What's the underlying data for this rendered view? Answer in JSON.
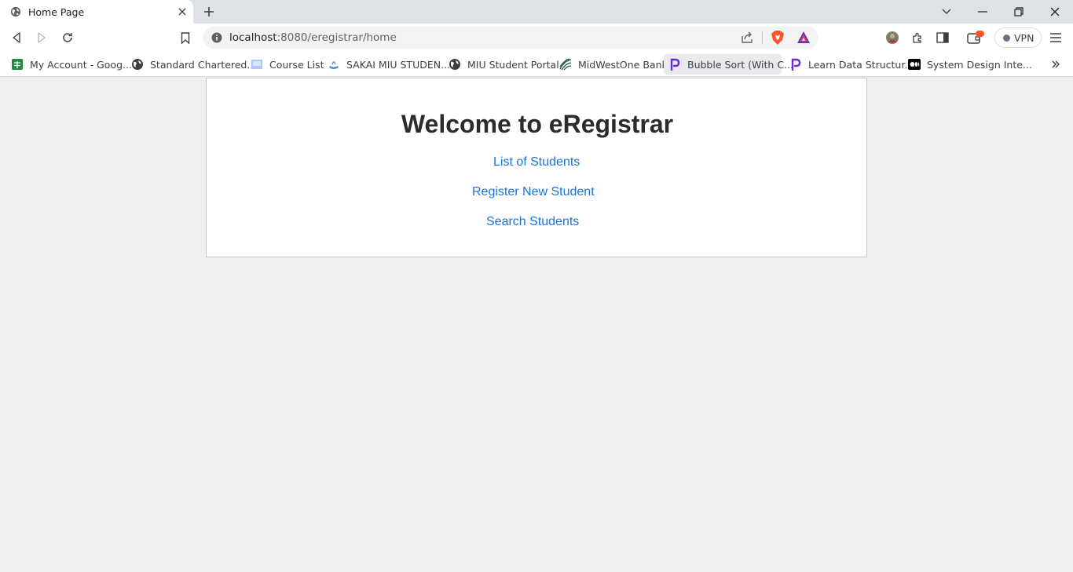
{
  "browser": {
    "tab": {
      "title": "Home Page"
    },
    "address_bar": {
      "host": "localhost",
      "path": ":8080/eregistrar/home"
    },
    "vpn_label": "VPN",
    "bookmarks": [
      {
        "label": "My Account - Goog...",
        "icon": "google-sheets-icon"
      },
      {
        "label": "Standard Chartered...",
        "icon": "globe-icon"
      },
      {
        "label": "Course List",
        "icon": "page-icon"
      },
      {
        "label": "SAKAI MIU STUDEN...",
        "icon": "sakai-icon"
      },
      {
        "label": "MIU Student Portal",
        "icon": "globe-icon"
      },
      {
        "label": "MidWestOne Bank",
        "icon": "bank-icon"
      },
      {
        "label": "Bubble Sort (With C...",
        "icon": "p-logo-icon"
      },
      {
        "label": "Learn Data Structur...",
        "icon": "p-logo-icon"
      },
      {
        "label": "System Design Inte...",
        "icon": "medium-icon"
      }
    ]
  },
  "page": {
    "heading": "Welcome to eRegistrar",
    "links": {
      "list_students": "List of Students",
      "register_student": "Register New Student",
      "search_students": "Search Students"
    }
  },
  "colors": {
    "link": "#1a73d9",
    "heading": "#2b2b2b",
    "page_background": "#efefef",
    "brave_orange": "#fb542b"
  }
}
